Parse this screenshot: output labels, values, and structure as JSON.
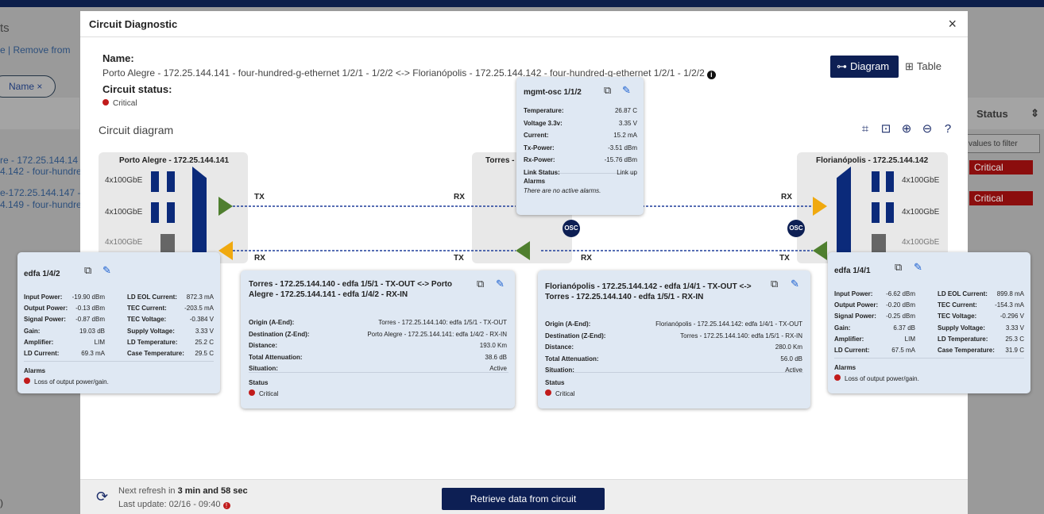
{
  "background": {
    "text1": "ts",
    "text2": "e | Remove from",
    "chip": "Name ×",
    "row1a": "re - 172.25.144.14",
    "row1b": "4.142 - four-hundre",
    "row2a": "e-172.25.144.147 -",
    "row2b": "4.149 - four-hundre",
    "status_header": "Status",
    "filter_placeholder": "values to filter",
    "crit1": "Critical",
    "crit2": "Critical",
    "bottom_left": ")"
  },
  "modal": {
    "title": "Circuit Diagnostic",
    "close": "×",
    "name_label": "Name:",
    "name_value": "Porto Alegre - 172.25.144.141 - four-hundred-g-ethernet 1/2/1 - 1/2/2 <-> Florianópolis - 172.25.144.142 - four-hundred-g-ethernet 1/2/1 - 1/2/2",
    "status_label": "Circuit status:",
    "status_value": "Critical",
    "diagram_btn": "Diagram",
    "table_btn": "Table",
    "section_title": "Circuit diagram"
  },
  "nodes": {
    "left_title": "Porto Alegre - 172.25.144.141",
    "mid_title": "Torres - 1",
    "right_title": "Florianópolis - 172.25.144.142",
    "port": "4x100GbE"
  },
  "links": {
    "tx": "TX",
    "rx": "RX",
    "osc": "OSC"
  },
  "mgmt_card": {
    "title": "mgmt-osc 1/1/2",
    "rows": [
      {
        "label": "Temperature:",
        "value": "26.87 C"
      },
      {
        "label": "Voltage 3.3v:",
        "value": "3.35 V"
      },
      {
        "label": "Current:",
        "value": "15.2 mA"
      },
      {
        "label": "Tx-Power:",
        "value": "-3.51 dBm"
      },
      {
        "label": "Rx-Power:",
        "value": "-15.76 dBm"
      },
      {
        "label": "Link Status:",
        "value": "Link up"
      }
    ],
    "alarms_title": "Alarms",
    "alarms_text": "There are no active alarms."
  },
  "edfa_left": {
    "title": "edfa 1/4/2",
    "col1": [
      {
        "label": "Input Power:",
        "value": "-19.90 dBm"
      },
      {
        "label": "Output Power:",
        "value": "-0.13 dBm"
      },
      {
        "label": "Signal Power:",
        "value": "-0.87 dBm"
      },
      {
        "label": "Gain:",
        "value": "19.03 dB"
      },
      {
        "label": "Amplifier:",
        "value": "LIM"
      },
      {
        "label": "LD Current:",
        "value": "69.3 mA"
      }
    ],
    "col2": [
      {
        "label": "LD EOL Current:",
        "value": "872.3 mA"
      },
      {
        "label": "TEC Current:",
        "value": "-203.5 mA"
      },
      {
        "label": "TEC Voltage:",
        "value": "-0.384 V"
      },
      {
        "label": "Supply Voltage:",
        "value": "3.33 V"
      },
      {
        "label": "LD Temperature:",
        "value": "25.2 C"
      },
      {
        "label": "Case Temperature:",
        "value": "29.5 C"
      }
    ],
    "alarms_title": "Alarms",
    "alarm": "Loss of output power/gain."
  },
  "edfa_right": {
    "title": "edfa 1/4/1",
    "col1": [
      {
        "label": "Input Power:",
        "value": "-6.62 dBm"
      },
      {
        "label": "Output Power:",
        "value": "-0.20 dBm"
      },
      {
        "label": "Signal Power:",
        "value": "-0.25 dBm"
      },
      {
        "label": "Gain:",
        "value": "6.37 dB"
      },
      {
        "label": "Amplifier:",
        "value": "LIM"
      },
      {
        "label": "LD Current:",
        "value": "67.5 mA"
      }
    ],
    "col2": [
      {
        "label": "LD EOL Current:",
        "value": "899.8 mA"
      },
      {
        "label": "TEC Current:",
        "value": "-154.3 mA"
      },
      {
        "label": "TEC Voltage:",
        "value": "-0.296 V"
      },
      {
        "label": "Supply Voltage:",
        "value": "3.33 V"
      },
      {
        "label": "LD Temperature:",
        "value": "25.3 C"
      },
      {
        "label": "Case Temperature:",
        "value": "31.9 C"
      }
    ],
    "alarms_title": "Alarms",
    "alarm": "Loss of output power/gain."
  },
  "link_left": {
    "title1": "Torres - 172.25.144.140 - edfa 1/5/1 - TX-OUT <-> Porto",
    "title2": "Alegre - 172.25.144.141 - edfa 1/4/2 - RX-IN",
    "rows": [
      {
        "label": "Origin (A-End):",
        "value": "Torres - 172.25.144.140: edfa 1/5/1 - TX-OUT"
      },
      {
        "label": "Destination (Z-End):",
        "value": "Porto Alegre - 172.25.144.141: edfa 1/4/2 - RX-IN"
      },
      {
        "label": "Distance:",
        "value": "193.0 Km"
      },
      {
        "label": "Total Attenuation:",
        "value": "38.6 dB"
      },
      {
        "label": "Situation:",
        "value": "Active"
      }
    ],
    "status_title": "Status",
    "status": "Critical"
  },
  "link_right": {
    "title1": "Florianópolis - 172.25.144.142 - edfa 1/4/1 - TX-OUT <->",
    "title2": "Torres - 172.25.144.140 - edfa 1/5/1 - RX-IN",
    "rows": [
      {
        "label": "Origin (A-End):",
        "value": "Florianópolis - 172.25.144.142: edfa 1/4/1 - TX-OUT"
      },
      {
        "label": "Destination (Z-End):",
        "value": "Torres - 172.25.144.140: edfa 1/5/1 - RX-IN"
      },
      {
        "label": "Distance:",
        "value": "280.0 Km"
      },
      {
        "label": "Total Attenuation:",
        "value": "56.0 dB"
      },
      {
        "label": "Situation:",
        "value": "Active"
      }
    ],
    "status_title": "Status",
    "status": "Critical"
  },
  "footer": {
    "refresh_prefix": "Next refresh in ",
    "refresh_time": "3 min and 58 sec",
    "last_update": "Last update: 02/16 - 09:40",
    "warn": "!",
    "retrieve": "Retrieve data from circuit"
  },
  "colors": {
    "navy": "#0d1f54",
    "green_arrow": "#4f7f2f",
    "amber_arrow": "#f0a90f",
    "critical": "#c11b1b"
  }
}
